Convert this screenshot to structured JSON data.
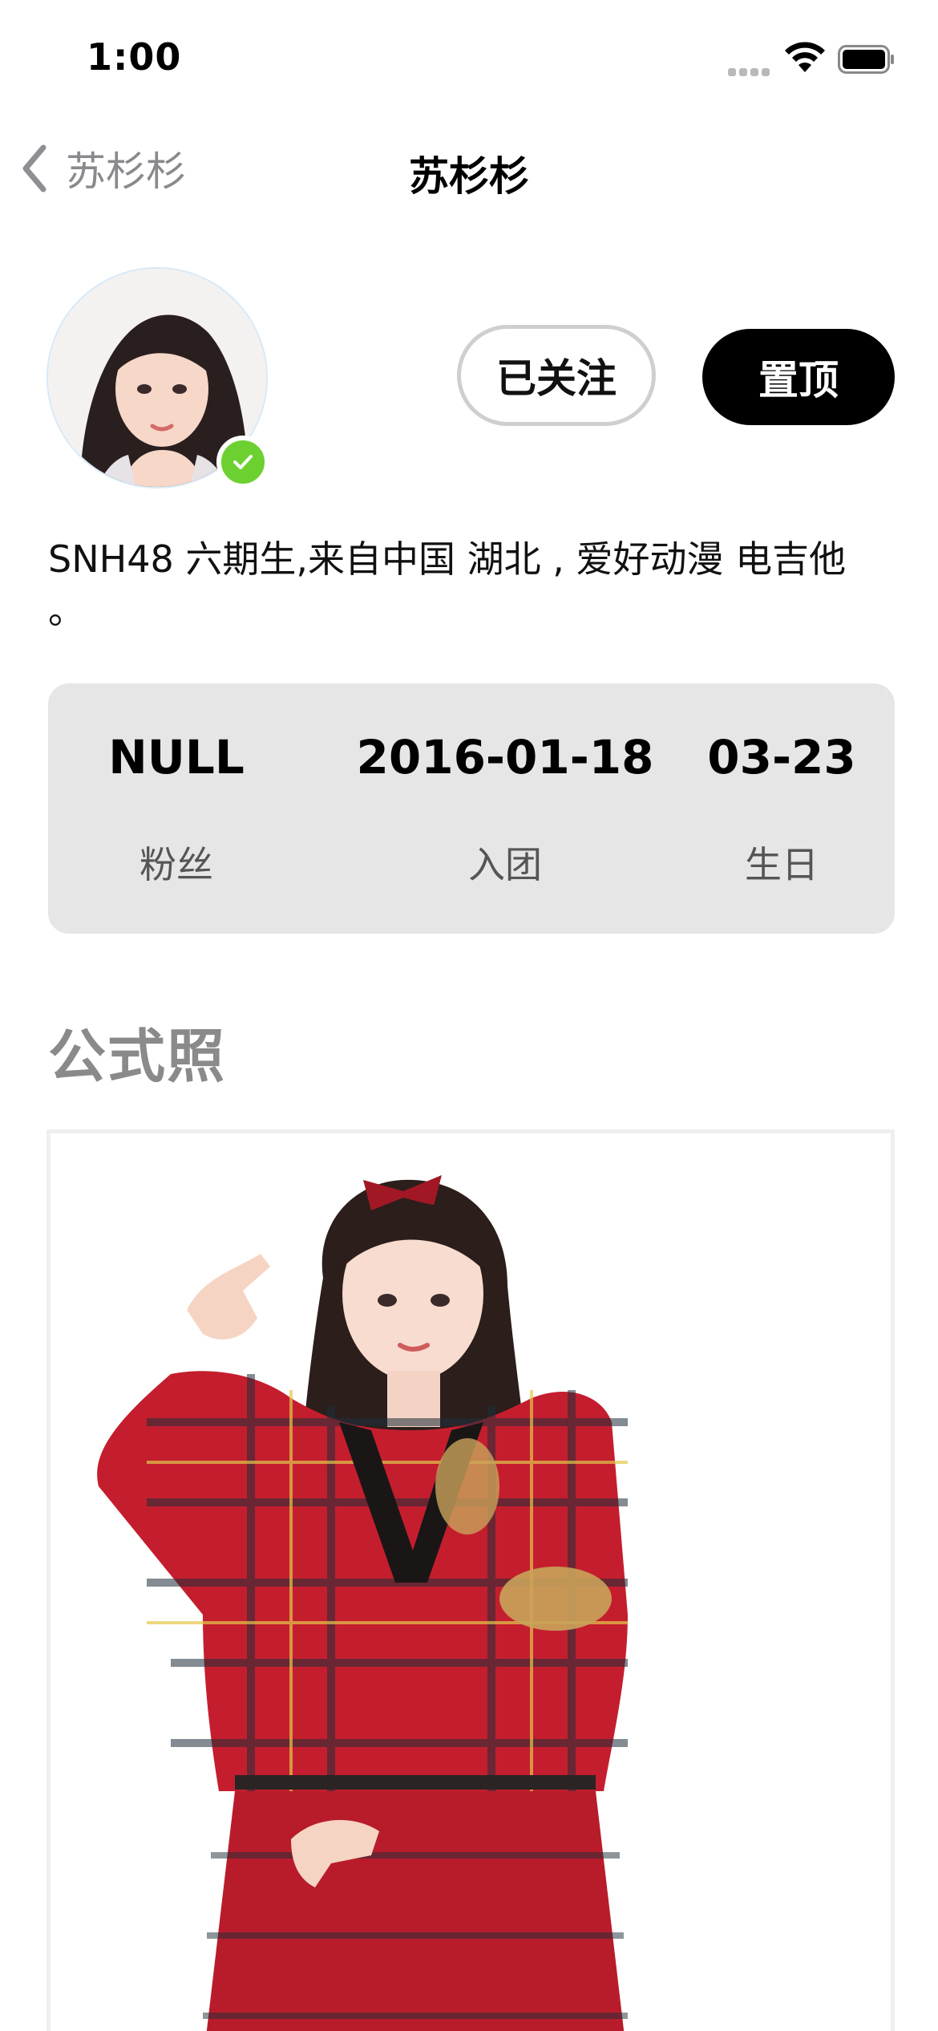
{
  "status_bar": {
    "time": "1:00"
  },
  "nav": {
    "back_label": "苏杉杉",
    "title": "苏杉杉"
  },
  "profile": {
    "follow_label": "已关注",
    "pin_label": "置顶",
    "bio": "SNH48 六期生,来自中国 湖北 , 爱好动漫 电吉他 。"
  },
  "stats": {
    "fans_value": "NULL",
    "fans_label": "粉丝",
    "join_value": "2016-01-18",
    "join_label": "入团",
    "birthday_value": "03-23",
    "birthday_label": "生日"
  },
  "section": {
    "official_photo_title": "公式照"
  },
  "colors": {
    "verified": "#6cd130",
    "card_bg": "#e6e6e6",
    "pin_bg": "#000000",
    "muted_text": "#8a8a8a"
  }
}
